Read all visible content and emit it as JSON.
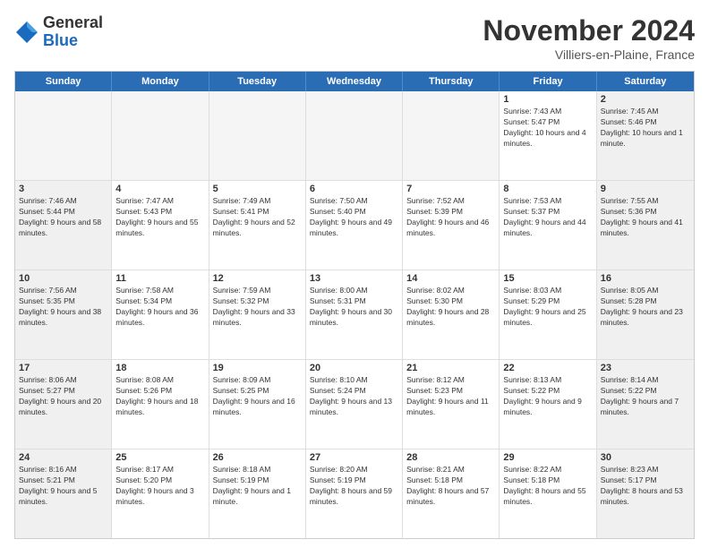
{
  "logo": {
    "general": "General",
    "blue": "Blue"
  },
  "header": {
    "month": "November 2024",
    "location": "Villiers-en-Plaine, France"
  },
  "days_of_week": [
    "Sunday",
    "Monday",
    "Tuesday",
    "Wednesday",
    "Thursday",
    "Friday",
    "Saturday"
  ],
  "weeks": [
    [
      {
        "day": "",
        "info": ""
      },
      {
        "day": "",
        "info": ""
      },
      {
        "day": "",
        "info": ""
      },
      {
        "day": "",
        "info": ""
      },
      {
        "day": "",
        "info": ""
      },
      {
        "day": "1",
        "info": "Sunrise: 7:43 AM\nSunset: 5:47 PM\nDaylight: 10 hours and 4 minutes."
      },
      {
        "day": "2",
        "info": "Sunrise: 7:45 AM\nSunset: 5:46 PM\nDaylight: 10 hours and 1 minute."
      }
    ],
    [
      {
        "day": "3",
        "info": "Sunrise: 7:46 AM\nSunset: 5:44 PM\nDaylight: 9 hours and 58 minutes."
      },
      {
        "day": "4",
        "info": "Sunrise: 7:47 AM\nSunset: 5:43 PM\nDaylight: 9 hours and 55 minutes."
      },
      {
        "day": "5",
        "info": "Sunrise: 7:49 AM\nSunset: 5:41 PM\nDaylight: 9 hours and 52 minutes."
      },
      {
        "day": "6",
        "info": "Sunrise: 7:50 AM\nSunset: 5:40 PM\nDaylight: 9 hours and 49 minutes."
      },
      {
        "day": "7",
        "info": "Sunrise: 7:52 AM\nSunset: 5:39 PM\nDaylight: 9 hours and 46 minutes."
      },
      {
        "day": "8",
        "info": "Sunrise: 7:53 AM\nSunset: 5:37 PM\nDaylight: 9 hours and 44 minutes."
      },
      {
        "day": "9",
        "info": "Sunrise: 7:55 AM\nSunset: 5:36 PM\nDaylight: 9 hours and 41 minutes."
      }
    ],
    [
      {
        "day": "10",
        "info": "Sunrise: 7:56 AM\nSunset: 5:35 PM\nDaylight: 9 hours and 38 minutes."
      },
      {
        "day": "11",
        "info": "Sunrise: 7:58 AM\nSunset: 5:34 PM\nDaylight: 9 hours and 36 minutes."
      },
      {
        "day": "12",
        "info": "Sunrise: 7:59 AM\nSunset: 5:32 PM\nDaylight: 9 hours and 33 minutes."
      },
      {
        "day": "13",
        "info": "Sunrise: 8:00 AM\nSunset: 5:31 PM\nDaylight: 9 hours and 30 minutes."
      },
      {
        "day": "14",
        "info": "Sunrise: 8:02 AM\nSunset: 5:30 PM\nDaylight: 9 hours and 28 minutes."
      },
      {
        "day": "15",
        "info": "Sunrise: 8:03 AM\nSunset: 5:29 PM\nDaylight: 9 hours and 25 minutes."
      },
      {
        "day": "16",
        "info": "Sunrise: 8:05 AM\nSunset: 5:28 PM\nDaylight: 9 hours and 23 minutes."
      }
    ],
    [
      {
        "day": "17",
        "info": "Sunrise: 8:06 AM\nSunset: 5:27 PM\nDaylight: 9 hours and 20 minutes."
      },
      {
        "day": "18",
        "info": "Sunrise: 8:08 AM\nSunset: 5:26 PM\nDaylight: 9 hours and 18 minutes."
      },
      {
        "day": "19",
        "info": "Sunrise: 8:09 AM\nSunset: 5:25 PM\nDaylight: 9 hours and 16 minutes."
      },
      {
        "day": "20",
        "info": "Sunrise: 8:10 AM\nSunset: 5:24 PM\nDaylight: 9 hours and 13 minutes."
      },
      {
        "day": "21",
        "info": "Sunrise: 8:12 AM\nSunset: 5:23 PM\nDaylight: 9 hours and 11 minutes."
      },
      {
        "day": "22",
        "info": "Sunrise: 8:13 AM\nSunset: 5:22 PM\nDaylight: 9 hours and 9 minutes."
      },
      {
        "day": "23",
        "info": "Sunrise: 8:14 AM\nSunset: 5:22 PM\nDaylight: 9 hours and 7 minutes."
      }
    ],
    [
      {
        "day": "24",
        "info": "Sunrise: 8:16 AM\nSunset: 5:21 PM\nDaylight: 9 hours and 5 minutes."
      },
      {
        "day": "25",
        "info": "Sunrise: 8:17 AM\nSunset: 5:20 PM\nDaylight: 9 hours and 3 minutes."
      },
      {
        "day": "26",
        "info": "Sunrise: 8:18 AM\nSunset: 5:19 PM\nDaylight: 9 hours and 1 minute."
      },
      {
        "day": "27",
        "info": "Sunrise: 8:20 AM\nSunset: 5:19 PM\nDaylight: 8 hours and 59 minutes."
      },
      {
        "day": "28",
        "info": "Sunrise: 8:21 AM\nSunset: 5:18 PM\nDaylight: 8 hours and 57 minutes."
      },
      {
        "day": "29",
        "info": "Sunrise: 8:22 AM\nSunset: 5:18 PM\nDaylight: 8 hours and 55 minutes."
      },
      {
        "day": "30",
        "info": "Sunrise: 8:23 AM\nSunset: 5:17 PM\nDaylight: 8 hours and 53 minutes."
      }
    ]
  ]
}
